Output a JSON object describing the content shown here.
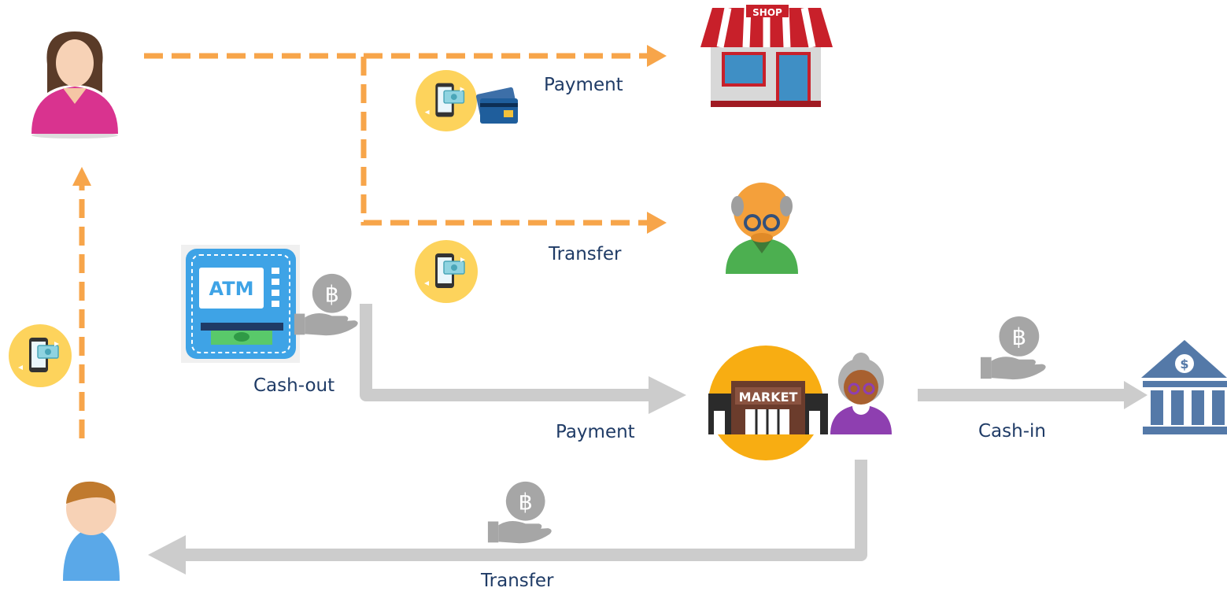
{
  "diagram": {
    "labels": {
      "payment_top": "Payment",
      "transfer_top": "Transfer",
      "cash_out": "Cash-out",
      "payment_bottom": "Payment",
      "cash_in": "Cash-in",
      "transfer_bottom": "Transfer"
    },
    "icon_text": {
      "shop_sign": "SHOP",
      "atm_screen": "ATM",
      "market_sign": "MARKET",
      "baht": "฿",
      "bank_sign": "$"
    },
    "colors": {
      "digital_flow": "#f7a54a",
      "cash_flow": "#cccccc",
      "label_text": "#1f3b66",
      "badge": "#fdd35c"
    }
  }
}
